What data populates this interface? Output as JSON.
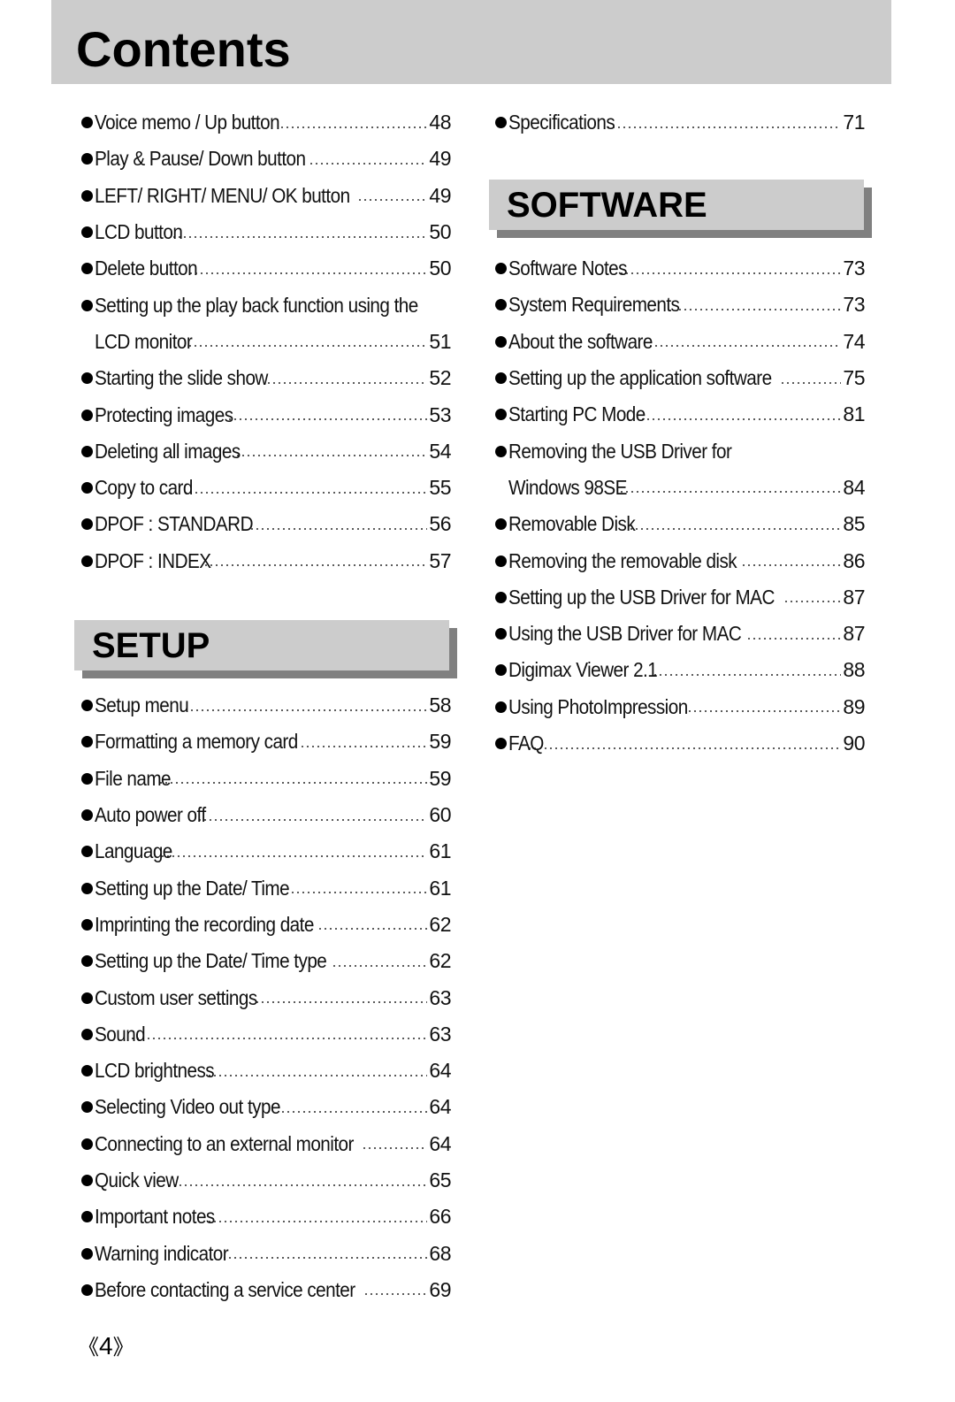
{
  "header": {
    "title": "Contents"
  },
  "left_column": {
    "items_top": [
      {
        "label": "Voice memo / Up button",
        "page": "48"
      },
      {
        "label": "Play & Pause/ Down button",
        "page": "49"
      },
      {
        "label": "LEFT/ RIGHT/ MENU/ OK button",
        "page": "49"
      },
      {
        "label": "LCD button",
        "page": "50"
      },
      {
        "label": "Delete button",
        "page": "50"
      },
      {
        "label": "Setting up the play back function using the",
        "continuation": "LCD monitor",
        "page": "51"
      },
      {
        "label": "Starting the slide show",
        "page": "52"
      },
      {
        "label": "Protecting images",
        "page": "53"
      },
      {
        "label": "Deleting all images",
        "page": "54"
      },
      {
        "label": "Copy to card",
        "page": "55"
      },
      {
        "label": "DPOF : STANDARD",
        "page": "56"
      },
      {
        "label": "DPOF : INDEX",
        "page": "57"
      }
    ],
    "setup_section": {
      "title": "SETUP",
      "items": [
        {
          "label": "Setup menu",
          "page": "58"
        },
        {
          "label": "Formatting a memory card",
          "page": "59"
        },
        {
          "label": "File name",
          "page": "59"
        },
        {
          "label": "Auto power off",
          "page": "60"
        },
        {
          "label": "Language",
          "page": "61"
        },
        {
          "label": "Setting up the Date/ Time",
          "page": "61"
        },
        {
          "label": "Imprinting the recording date",
          "page": "62"
        },
        {
          "label": "Setting up the Date/ Time type",
          "page": "62"
        },
        {
          "label": "Custom user settings",
          "page": "63"
        },
        {
          "label": "Sound",
          "page": "63"
        },
        {
          "label": "LCD brightness",
          "page": "64"
        },
        {
          "label": "Selecting Video out type",
          "page": "64"
        },
        {
          "label": "Connecting to an external monitor",
          "page": "64"
        },
        {
          "label": "Quick view",
          "page": "65"
        },
        {
          "label": "Important notes",
          "page": "66"
        },
        {
          "label": "Warning indicator",
          "page": "68"
        },
        {
          "label": "Before contacting a service center",
          "page": "69"
        }
      ]
    }
  },
  "right_column": {
    "items_top": [
      {
        "label": "Specifications",
        "page": "71"
      }
    ],
    "software_section": {
      "title": "SOFTWARE",
      "items": [
        {
          "label": "Software Notes",
          "page": "73"
        },
        {
          "label": "System Requirements",
          "page": "73"
        },
        {
          "label": "About the software",
          "page": "74"
        },
        {
          "label": "Setting up the application software",
          "page": "75"
        },
        {
          "label": "Starting PC Mode",
          "page": "81"
        },
        {
          "label": "Removing the USB Driver for",
          "continuation": "Windows 98SE",
          "page": "84"
        },
        {
          "label": "Removable Disk",
          "page": "85"
        },
        {
          "label": "Removing the removable disk",
          "page": "86"
        },
        {
          "label": "Setting up the USB Driver for MAC",
          "page": "87"
        },
        {
          "label": "Using the USB Driver for MAC",
          "page": "87"
        },
        {
          "label": "Digimax Viewer 2.1",
          "page": "88"
        },
        {
          "label": "Using PhotoImpression",
          "page": "89"
        },
        {
          "label": "FAQ",
          "page": "90"
        }
      ]
    }
  },
  "footer": {
    "page_number": "4",
    "left_mark": "《",
    "right_mark": "》"
  }
}
